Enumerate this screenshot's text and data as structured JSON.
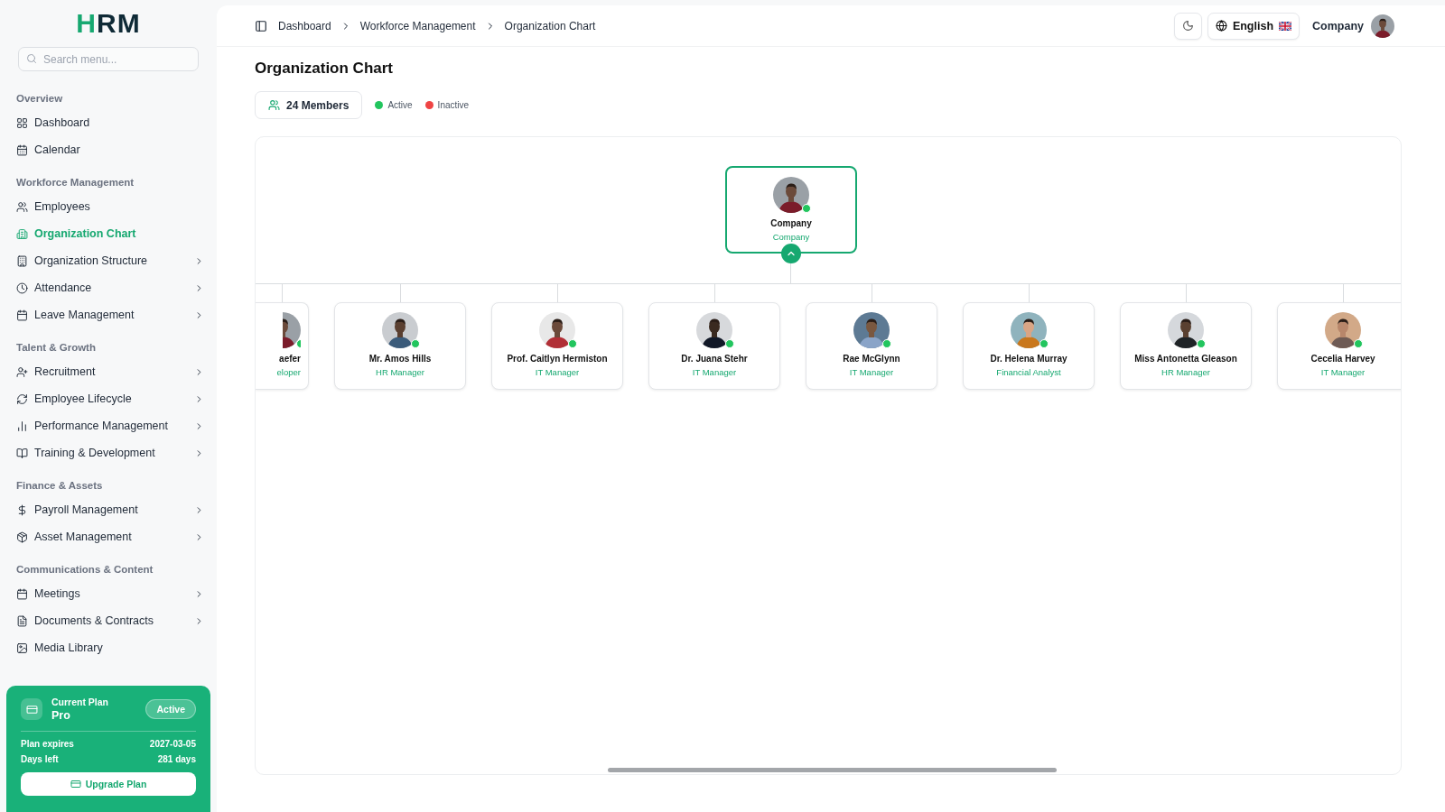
{
  "sidebar": {
    "logo": "HRM",
    "search": {
      "placeholder": "Search menu..."
    },
    "sections": [
      {
        "title": "Overview",
        "items": [
          {
            "label": "Dashboard",
            "selected": false,
            "expandable": false
          },
          {
            "label": "Calendar",
            "selected": false,
            "expandable": false
          }
        ]
      },
      {
        "title": "Workforce Management",
        "items": [
          {
            "label": "Employees",
            "selected": false,
            "expandable": false
          },
          {
            "label": "Organization Chart",
            "selected": true,
            "expandable": false
          },
          {
            "label": "Organization Structure",
            "selected": false,
            "expandable": true
          },
          {
            "label": "Attendance",
            "selected": false,
            "expandable": true
          },
          {
            "label": "Leave Management",
            "selected": false,
            "expandable": true
          }
        ]
      },
      {
        "title": "Talent & Growth",
        "items": [
          {
            "label": "Recruitment",
            "selected": false,
            "expandable": true
          },
          {
            "label": "Employee Lifecycle",
            "selected": false,
            "expandable": true
          },
          {
            "label": "Performance Management",
            "selected": false,
            "expandable": true
          },
          {
            "label": "Training & Development",
            "selected": false,
            "expandable": true
          }
        ]
      },
      {
        "title": "Finance & Assets",
        "items": [
          {
            "label": "Payroll Management",
            "selected": false,
            "expandable": true
          },
          {
            "label": "Asset Management",
            "selected": false,
            "expandable": true
          }
        ]
      },
      {
        "title": "Communications & Content",
        "items": [
          {
            "label": "Meetings",
            "selected": false,
            "expandable": true
          },
          {
            "label": "Documents & Contracts",
            "selected": false,
            "expandable": true
          },
          {
            "label": "Media Library",
            "selected": false,
            "expandable": false
          }
        ]
      }
    ],
    "plan": {
      "label": "Current Plan",
      "name": "Pro",
      "badge": "Active",
      "rows": [
        {
          "label": "Plan expires",
          "value": "2027-03-05"
        },
        {
          "label": "Days left",
          "value": "281 days"
        }
      ],
      "button": "Upgrade Plan"
    }
  },
  "header": {
    "breadcrumbs": [
      "Dashboard",
      "Workforce Management",
      "Organization Chart"
    ],
    "language": "English",
    "user": "Company"
  },
  "page": {
    "title": "Organization Chart",
    "members": "24 Members",
    "legend": [
      {
        "label": "Active",
        "color": "#22c55e"
      },
      {
        "label": "Inactive",
        "color": "#ef4444"
      }
    ]
  },
  "chart": {
    "root": {
      "name": "Company",
      "role": "Company",
      "active": true,
      "expanded": true
    },
    "children": [
      {
        "kind": "cut",
        "name": "aefer",
        "role": "eloper",
        "active": true
      },
      {
        "kind": "full",
        "name": "Mr. Amos Hills",
        "role": "HR Manager",
        "active": true
      },
      {
        "kind": "full",
        "name": "Prof. Caitlyn Hermiston",
        "role": "IT Manager",
        "active": true
      },
      {
        "kind": "full",
        "name": "Dr. Juana Stehr",
        "role": "IT Manager",
        "active": true
      },
      {
        "kind": "full",
        "name": "Rae McGlynn",
        "role": "IT Manager",
        "active": true
      },
      {
        "kind": "full",
        "name": "Dr. Helena Murray",
        "role": "Financial Analyst",
        "active": true
      },
      {
        "kind": "full",
        "name": "Miss Antonetta Gleason",
        "role": "HR Manager",
        "active": true
      },
      {
        "kind": "full",
        "name": "Cecelia Harvey",
        "role": "IT Manager",
        "active": true
      }
    ]
  }
}
